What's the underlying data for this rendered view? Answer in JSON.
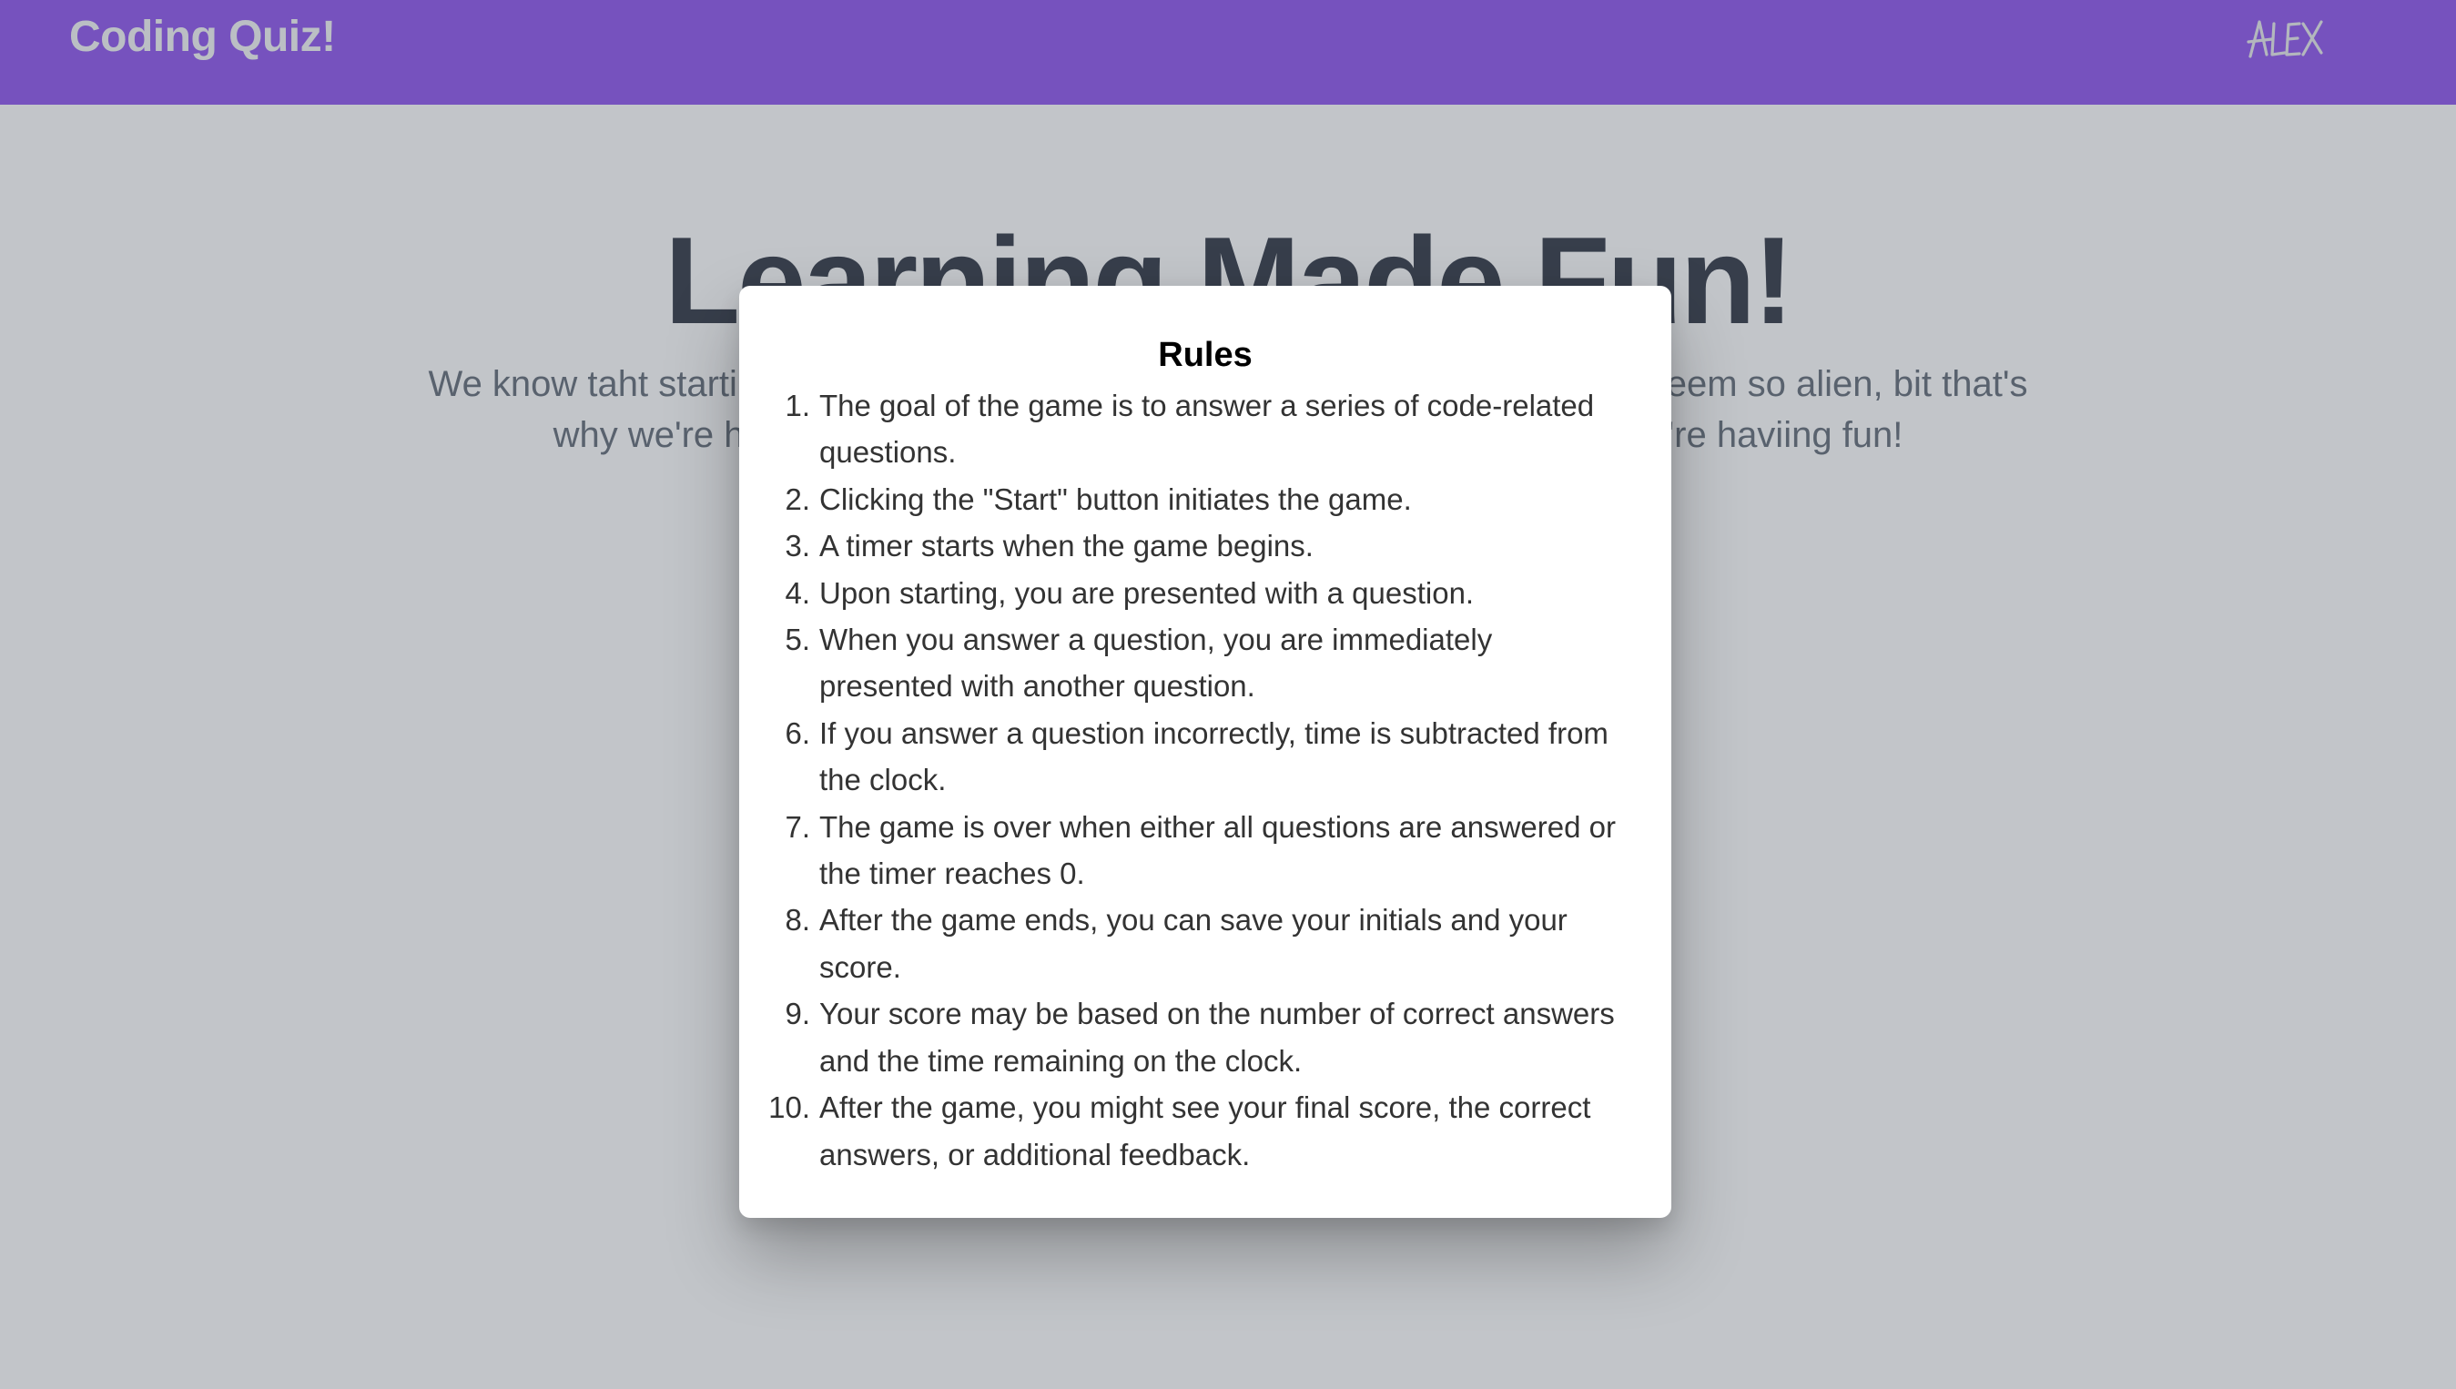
{
  "header": {
    "brand": "Coding Quiz!",
    "logo_label": "ALEX",
    "background": "#7c3aed"
  },
  "hero": {
    "title": "Learning Made Fun!",
    "text": "We know taht starting to learn code can be daunting, and the language can seem so alien, bit that's why we're here to help you learn what you need to know all while you're haviing fun!"
  },
  "modal": {
    "title": "Rules",
    "rules": [
      {
        "num": "1.",
        "text": "The goal of the game is to answer a series of code-related questions."
      },
      {
        "num": "2.",
        "text": "Clicking the \"Start\" button initiates the game."
      },
      {
        "num": "3.",
        "text": "A timer starts when the game begins."
      },
      {
        "num": "4.",
        "text": "Upon starting, you are presented with a question."
      },
      {
        "num": "5.",
        "text": "When you answer a question, you are immediately presented with another question."
      },
      {
        "num": "6.",
        "text": "If you answer a question incorrectly, time is subtracted from the clock."
      },
      {
        "num": "7.",
        "text": "The game is over when either all questions are answered or the timer reaches 0."
      },
      {
        "num": "8.",
        "text": "After the game ends, you can save your initials and your score."
      },
      {
        "num": "9.",
        "text": "Your score may be based on the number of correct answers and the time remaining on the clock."
      },
      {
        "num": "10.",
        "text": "After the game, you might see your final score, the correct answers, or additional feedback."
      }
    ]
  }
}
